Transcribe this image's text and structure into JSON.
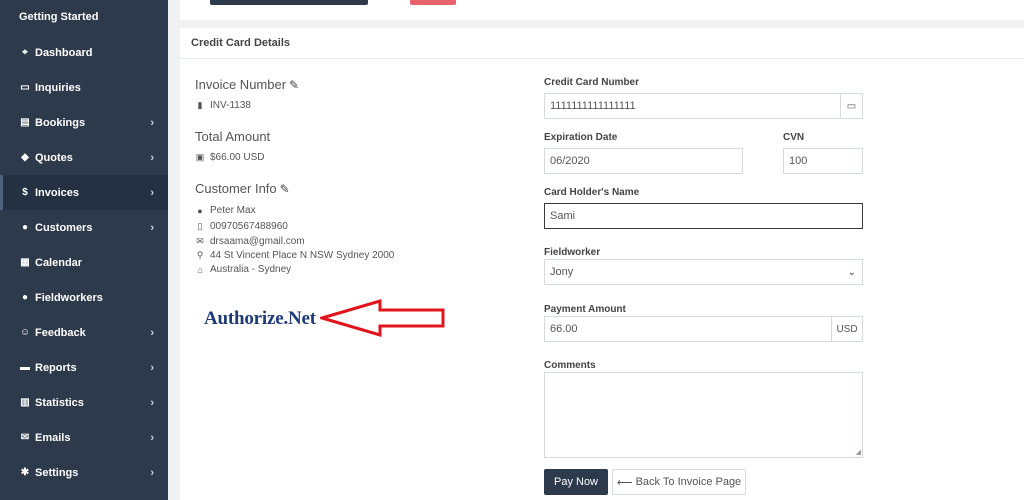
{
  "sidebar": {
    "title": "Getting Started",
    "items": [
      {
        "label": "Dashboard",
        "icon": "dashboard-icon",
        "glyph": "⌖",
        "has_children": false
      },
      {
        "label": "Inquiries",
        "icon": "inbox-icon",
        "glyph": "▭",
        "has_children": false
      },
      {
        "label": "Bookings",
        "icon": "book-icon",
        "glyph": "▤",
        "has_children": true
      },
      {
        "label": "Quotes",
        "icon": "tag-icon",
        "glyph": "◆",
        "has_children": true
      },
      {
        "label": "Invoices",
        "icon": "dollar-icon",
        "glyph": "$",
        "has_children": true,
        "active": true
      },
      {
        "label": "Customers",
        "icon": "user-icon",
        "glyph": "●",
        "has_children": true
      },
      {
        "label": "Calendar",
        "icon": "calendar-icon",
        "glyph": "▦",
        "has_children": false
      },
      {
        "label": "Fieldworkers",
        "icon": "user-icon",
        "glyph": "●",
        "has_children": false
      },
      {
        "label": "Feedback",
        "icon": "smile-icon",
        "glyph": "☺",
        "has_children": true
      },
      {
        "label": "Reports",
        "icon": "folder-icon",
        "glyph": "▬",
        "has_children": true
      },
      {
        "label": "Statistics",
        "icon": "chart-icon",
        "glyph": "▥",
        "has_children": true
      },
      {
        "label": "Emails",
        "icon": "envelope-icon",
        "glyph": "✉",
        "has_children": true
      },
      {
        "label": "Settings",
        "icon": "gear-icon",
        "glyph": "✱",
        "has_children": true
      }
    ]
  },
  "card": {
    "header": "Credit Card Details"
  },
  "invoice": {
    "number_label": "Invoice Number",
    "number": "INV-1138",
    "total_label": "Total Amount",
    "total": "$66.00 USD"
  },
  "customer": {
    "label": "Customer Info",
    "name": "Peter Max",
    "phone": "00970567488960",
    "email": "drsaama@gmail.com",
    "address": "44 St Vincent Place N NSW Sydney 2000",
    "location": "Australia - Sydney"
  },
  "branding": {
    "logo_text": "Authorize.Net",
    "arrow_color": "#e0141b"
  },
  "form": {
    "cc_number_label": "Credit Card Number",
    "cc_number": "1111111111111111",
    "expiration_label": "Expiration Date",
    "expiration": "06/2020",
    "cvn_label": "CVN",
    "cvn": "100",
    "holder_label": "Card Holder's Name",
    "holder": "Sami",
    "fieldworker_label": "Fieldworker",
    "fieldworker": "Jony",
    "amount_label": "Payment Amount",
    "amount": "66.00",
    "currency": "USD",
    "comments_label": "Comments",
    "comments": ""
  },
  "actions": {
    "pay": "Pay Now",
    "back": "Back To Invoice Page"
  },
  "colors": {
    "sidebar_bg": "#2d3a4b",
    "primary_button": "#2c3a4b",
    "danger_button": "#e8626c",
    "logo": "#1e3a78"
  }
}
